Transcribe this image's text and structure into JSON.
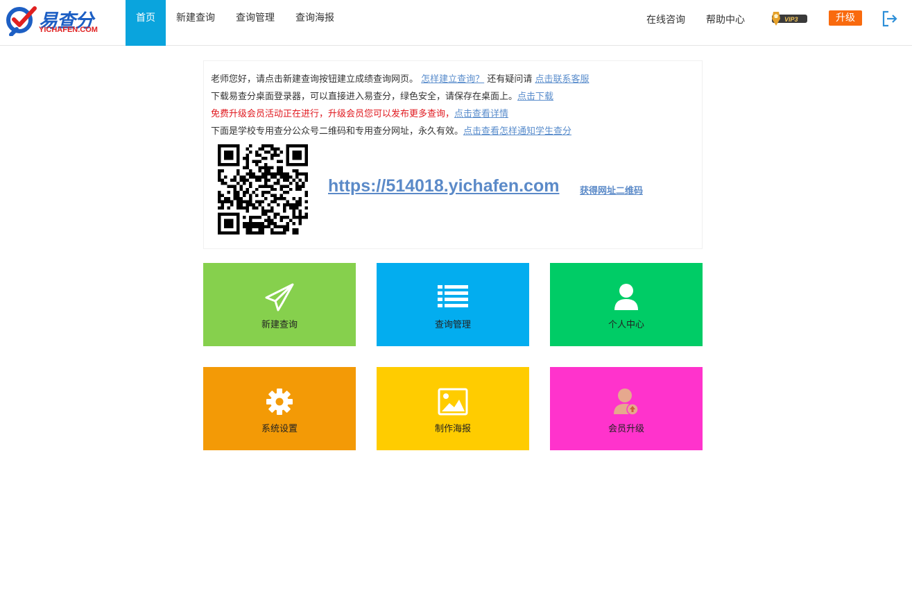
{
  "brand": {
    "name_cn": "易查分",
    "name_en": "YICHAFEN.COM",
    "primary_color": "#1d5fc4",
    "accent_color": "#e02020"
  },
  "nav": {
    "items": [
      {
        "label": "首页",
        "active": true
      },
      {
        "label": "新建查询",
        "active": false
      },
      {
        "label": "查询管理",
        "active": false
      },
      {
        "label": "查询海报",
        "active": false
      }
    ],
    "active_color": "#0aa4dd"
  },
  "right_nav": {
    "online_consult": "在线咨询",
    "help_center": "帮助中心",
    "vip_level": "VIP3",
    "upgrade_label": "升级",
    "upgrade_color": "#f96a0e",
    "logout_icon": "logout-icon"
  },
  "notice": {
    "line1_text": "老师您好，请点击新建查询按钮建立成绩查询网页。",
    "line1_link1": "怎样建立查询？",
    "line1_text2": "还有疑问请",
    "line1_link2": "点击联系客服",
    "line2_text": "下载易查分桌面登录器，可以直接进入易查分，绿色安全，请保存在桌面上。",
    "line2_link": "点击下载",
    "line3_text": "免费升级会员活动正在进行，升级会员您可以发布更多查询，",
    "line3_link": "点击查看详情",
    "line4_text": "下面是学校专用查分公众号二维码和专用查分网址，永久有效。",
    "line4_link": "点击查看怎样通知学生查分",
    "url": "https://514018.yichafen.com",
    "qr_link": "获得网址二维码"
  },
  "tiles": [
    {
      "label": "新建查询",
      "icon": "paper-plane-icon",
      "color": "#86d04d"
    },
    {
      "label": "查询管理",
      "icon": "list-icon",
      "color": "#03adef"
    },
    {
      "label": "个人中心",
      "icon": "user-icon",
      "color": "#00cc66"
    },
    {
      "label": "系统设置",
      "icon": "gear-icon",
      "color": "#f39a06"
    },
    {
      "label": "制作海报",
      "icon": "image-icon",
      "color": "#ffcc00"
    },
    {
      "label": "会员升级",
      "icon": "member-upgrade-icon",
      "color": "#ff33cc"
    }
  ]
}
